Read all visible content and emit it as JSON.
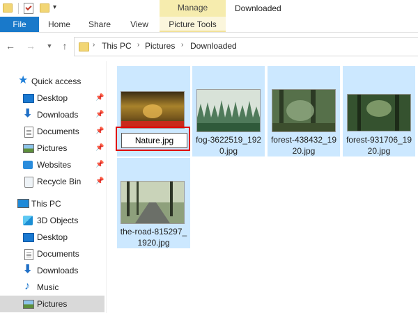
{
  "window": {
    "title": "Downloaded",
    "context_tab_header": "Manage"
  },
  "ribbon": {
    "tabs": [
      {
        "label": "File"
      },
      {
        "label": "Home"
      },
      {
        "label": "Share"
      },
      {
        "label": "View"
      },
      {
        "label": "Picture Tools"
      }
    ]
  },
  "address": {
    "crumbs": [
      "This PC",
      "Pictures",
      "Downloaded"
    ]
  },
  "sidebar": {
    "quick_access_label": "Quick access",
    "quick_access": [
      {
        "label": "Desktop",
        "icon": "desktop-icon",
        "pinned": true
      },
      {
        "label": "Downloads",
        "icon": "download-icon",
        "pinned": true
      },
      {
        "label": "Documents",
        "icon": "documents-icon",
        "pinned": true
      },
      {
        "label": "Pictures",
        "icon": "pictures-icon",
        "pinned": true
      },
      {
        "label": "Websites",
        "icon": "network-folder-icon",
        "pinned": true
      },
      {
        "label": "Recycle Bin",
        "icon": "recycle-bin-icon",
        "pinned": true
      }
    ],
    "this_pc_label": "This PC",
    "this_pc": [
      {
        "label": "3D Objects",
        "icon": "3d-objects-icon"
      },
      {
        "label": "Desktop",
        "icon": "desktop-icon"
      },
      {
        "label": "Documents",
        "icon": "documents-icon"
      },
      {
        "label": "Downloads",
        "icon": "download-icon"
      },
      {
        "label": "Music",
        "icon": "music-icon"
      },
      {
        "label": "Pictures",
        "icon": "pictures-icon",
        "selected": true
      }
    ]
  },
  "files": [
    {
      "name": "Nature.jpg",
      "renaming": true
    },
    {
      "name": "fog-3622519_1920.jpg"
    },
    {
      "name": "forest-438432_1920.jpg"
    },
    {
      "name": "forest-931706_1920.jpg"
    },
    {
      "name": "the-road-815297_1920.jpg"
    }
  ],
  "file_name_display": {
    "fog": [
      "fog-3622519_192",
      "0.jpg"
    ],
    "forest1": [
      "forest-438432_19",
      "20.jpg"
    ],
    "forest2": [
      "forest-931706_19",
      "20.jpg"
    ],
    "road": [
      "the-road-815297_",
      "1920.jpg"
    ]
  },
  "colors": {
    "accent": "#1979ca",
    "selection": "#cce8ff",
    "context_tab": "#f6ecae",
    "highlight_frame": "#e00000"
  }
}
